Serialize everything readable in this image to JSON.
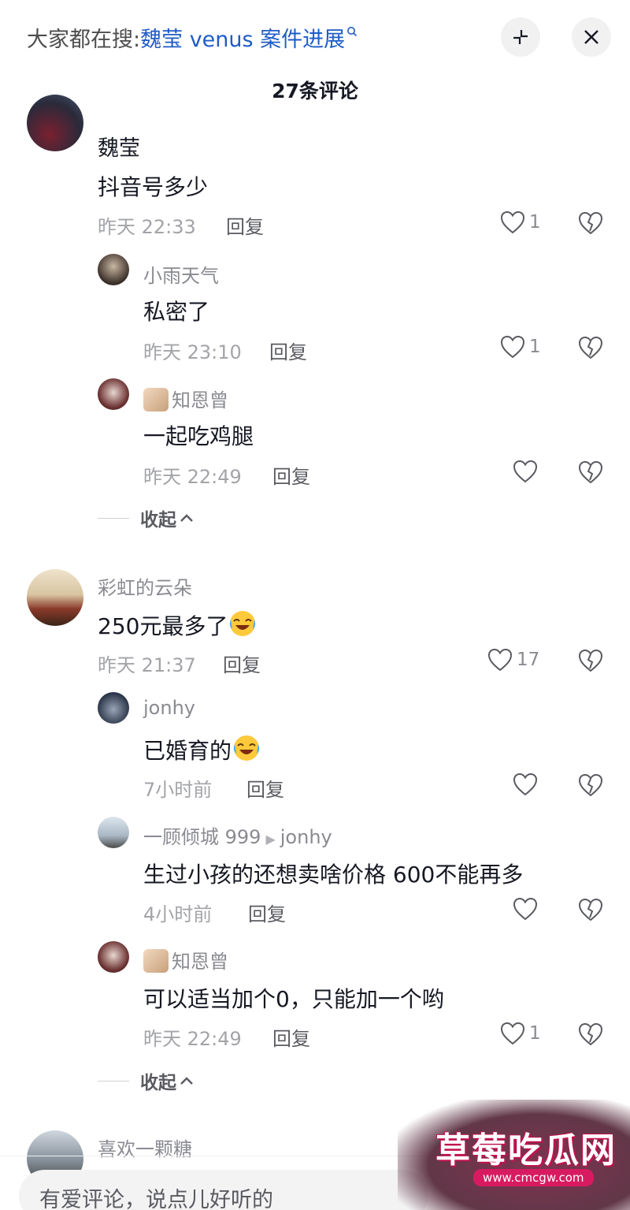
{
  "header": {
    "search_prefix": "大家都在搜:",
    "search_keyword": "魏莹 venus 案件进展",
    "comment_count": "27条评论"
  },
  "comments": {
    "c1": {
      "user": "魏莹",
      "text": "抖音号多少",
      "time": "昨天 22:33",
      "reply_label": "回复",
      "likes": "1",
      "replies": {
        "r1": {
          "user": "小雨天气",
          "text": "私密了",
          "time": "昨天 23:10",
          "reply_label": "回复",
          "likes": "1"
        },
        "r2": {
          "user": "知恩曾",
          "text": "一起吃鸡腿",
          "time": "昨天 22:49",
          "reply_label": "回复",
          "likes": ""
        }
      },
      "collapse_label": "收起"
    },
    "c2": {
      "user": "彩虹的云朵",
      "text": "250元最多了",
      "time": "昨天 21:37",
      "reply_label": "回复",
      "likes": "17",
      "replies": {
        "r1": {
          "user": "jonhy",
          "text": "已婚育的",
          "time": "7小时前",
          "reply_label": "回复",
          "likes": ""
        },
        "r2": {
          "user": "一顾倾城 999",
          "reply_to": "jonhy",
          "text": "生过小孩的还想卖啥价格 600不能再多",
          "time": "4小时前",
          "reply_label": "回复",
          "likes": ""
        },
        "r3": {
          "user": "知恩曾",
          "text": "可以适当加个0，只能加一个哟",
          "time": "昨天 22:49",
          "reply_label": "回复",
          "likes": "1"
        }
      },
      "collapse_label": "收起"
    },
    "c3": {
      "user": "喜欢一颗糖"
    }
  },
  "input": {
    "placeholder": "有爱评论，说点儿好听的"
  },
  "watermark": {
    "title": "草莓吃瓜网",
    "url": "www.cmcgw.com"
  },
  "colors": {
    "link": "#1f5cc7",
    "text": "#161823",
    "muted": "#a3a4a8"
  },
  "icons": [
    "search-icon",
    "collapse-icon",
    "close-icon",
    "heart-icon",
    "broken-heart-icon",
    "chevron-up-icon",
    "laughing-crying-emoji"
  ]
}
